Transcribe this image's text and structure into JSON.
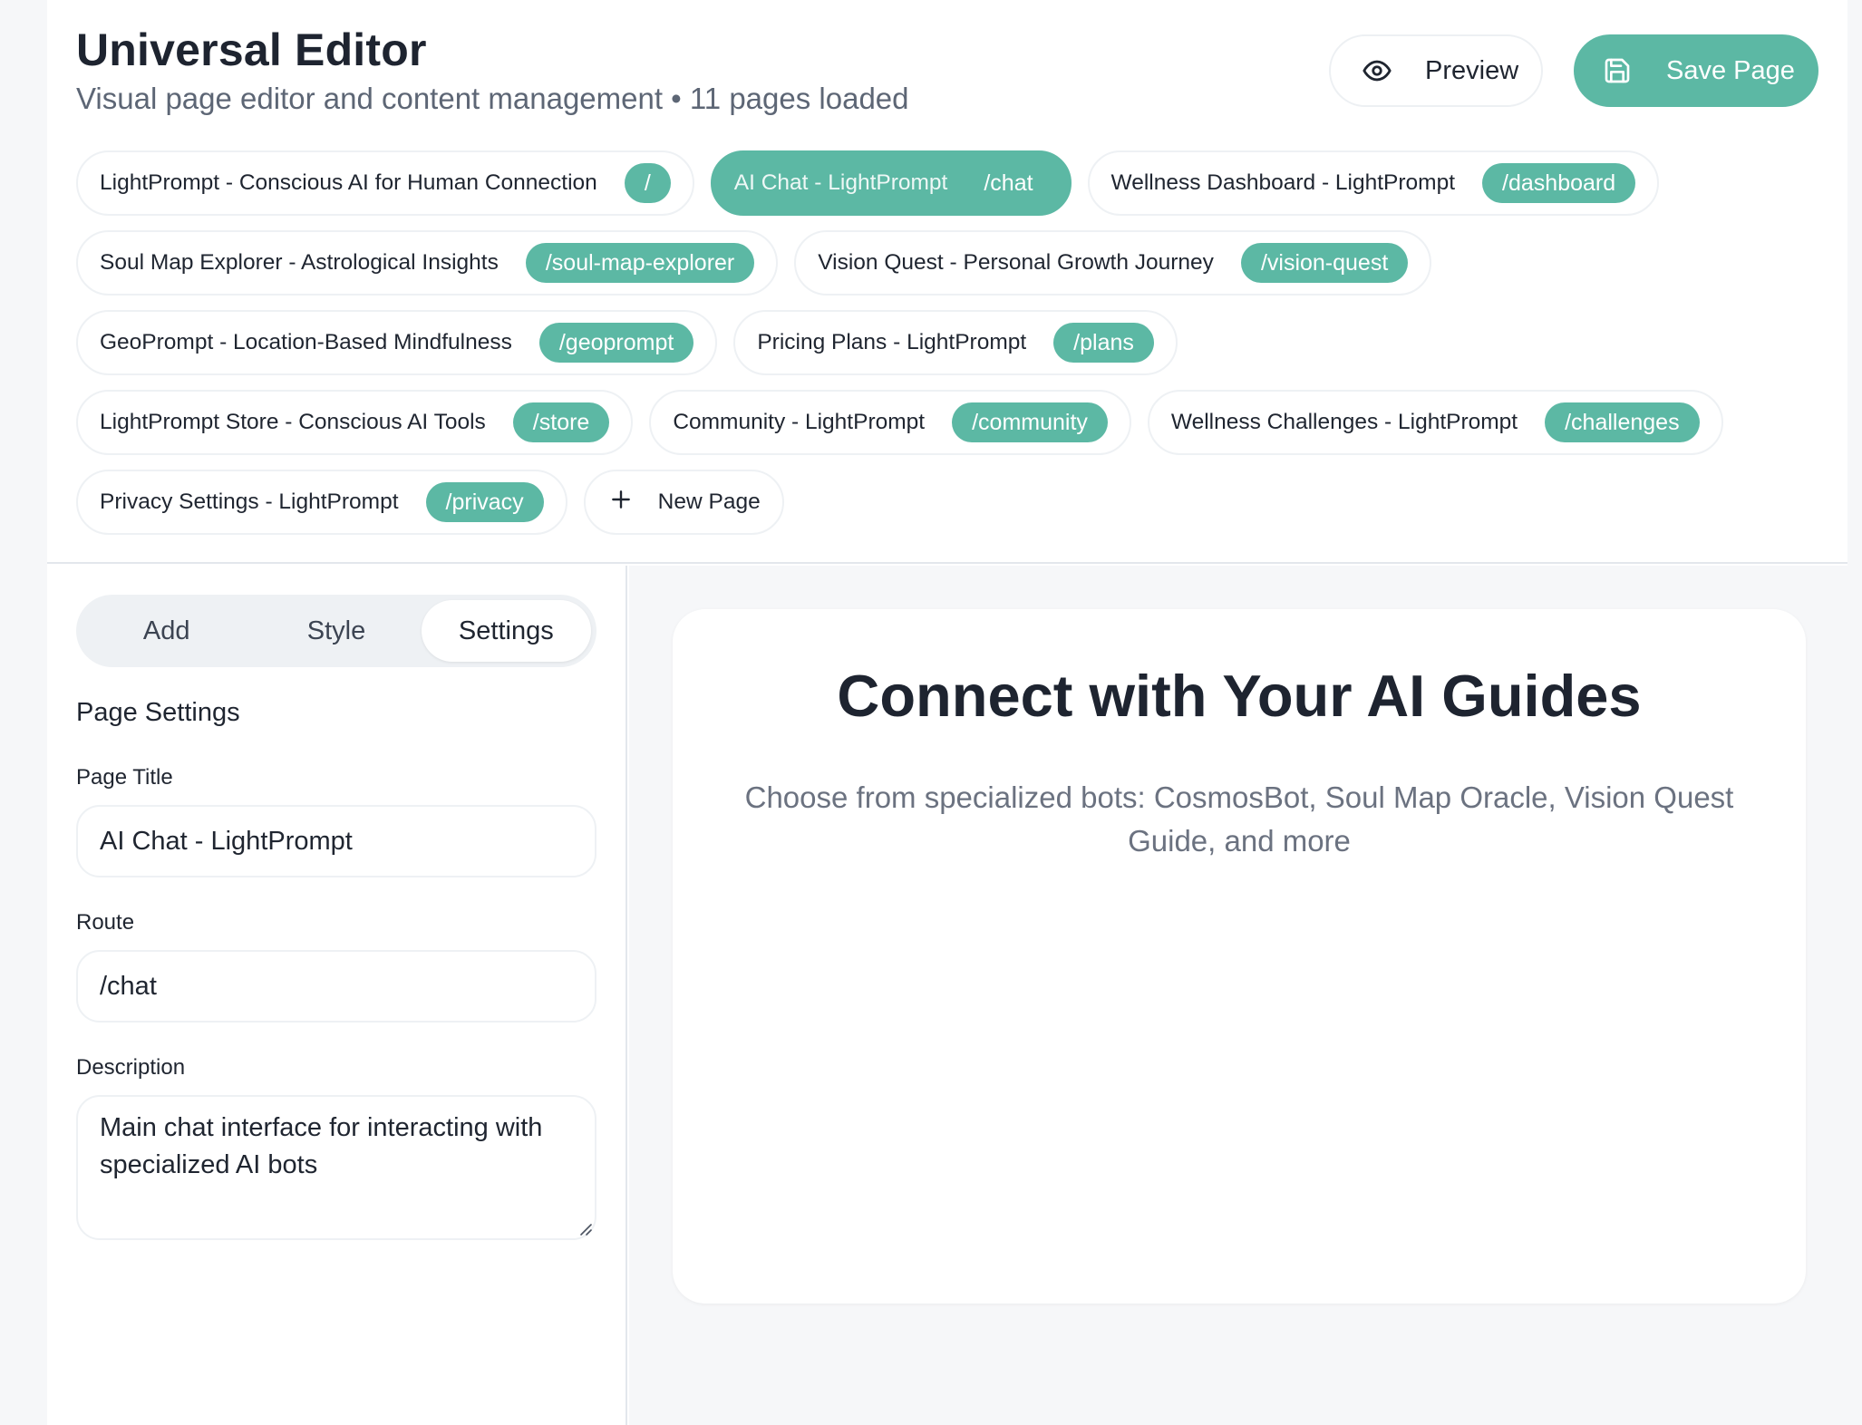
{
  "header": {
    "title": "Universal Editor",
    "subtitle": "Visual page editor and content management • 11 pages loaded",
    "preview_label": "Preview",
    "save_label": "Save Page"
  },
  "pages": [
    {
      "title": "LightPrompt - Conscious AI for Human Connection",
      "route": "/"
    },
    {
      "title": "AI Chat - LightPrompt",
      "route": "/chat",
      "active": true
    },
    {
      "title": "Wellness Dashboard - LightPrompt",
      "route": "/dashboard"
    },
    {
      "title": "Soul Map Explorer - Astrological Insights",
      "route": "/soul-map-explorer"
    },
    {
      "title": "Vision Quest - Personal Growth Journey",
      "route": "/vision-quest"
    },
    {
      "title": "GeoPrompt - Location-Based Mindfulness",
      "route": "/geoprompt"
    },
    {
      "title": "Pricing Plans - LightPrompt",
      "route": "/plans"
    },
    {
      "title": "LightPrompt Store - Conscious AI Tools",
      "route": "/store"
    },
    {
      "title": "Community - LightPrompt",
      "route": "/community"
    },
    {
      "title": "Wellness Challenges - LightPrompt",
      "route": "/challenges"
    },
    {
      "title": "Privacy Settings - LightPrompt",
      "route": "/privacy"
    }
  ],
  "new_page_label": "New Page",
  "sidebar": {
    "tabs": [
      "Add",
      "Style",
      "Settings"
    ],
    "active_tab": "Settings",
    "section_title": "Page Settings",
    "page_title_label": "Page Title",
    "page_title_value": "AI Chat - LightPrompt",
    "route_label": "Route",
    "route_value": "/chat",
    "description_label": "Description",
    "description_value": "Main chat interface for interacting with specialized AI bots"
  },
  "canvas": {
    "hero_title": "Connect with Your AI Guides",
    "hero_subtitle": "Choose from specialized bots: CosmosBot, Soul Map Oracle, Vision Quest Guide, and more"
  },
  "colors": {
    "accent": "#5cb8a4",
    "text": "#1f2530",
    "muted": "#6b7280",
    "background": "#f6f7f9"
  },
  "icons": {
    "preview": "eye-icon",
    "save": "save-icon",
    "new_page": "plus-icon"
  }
}
